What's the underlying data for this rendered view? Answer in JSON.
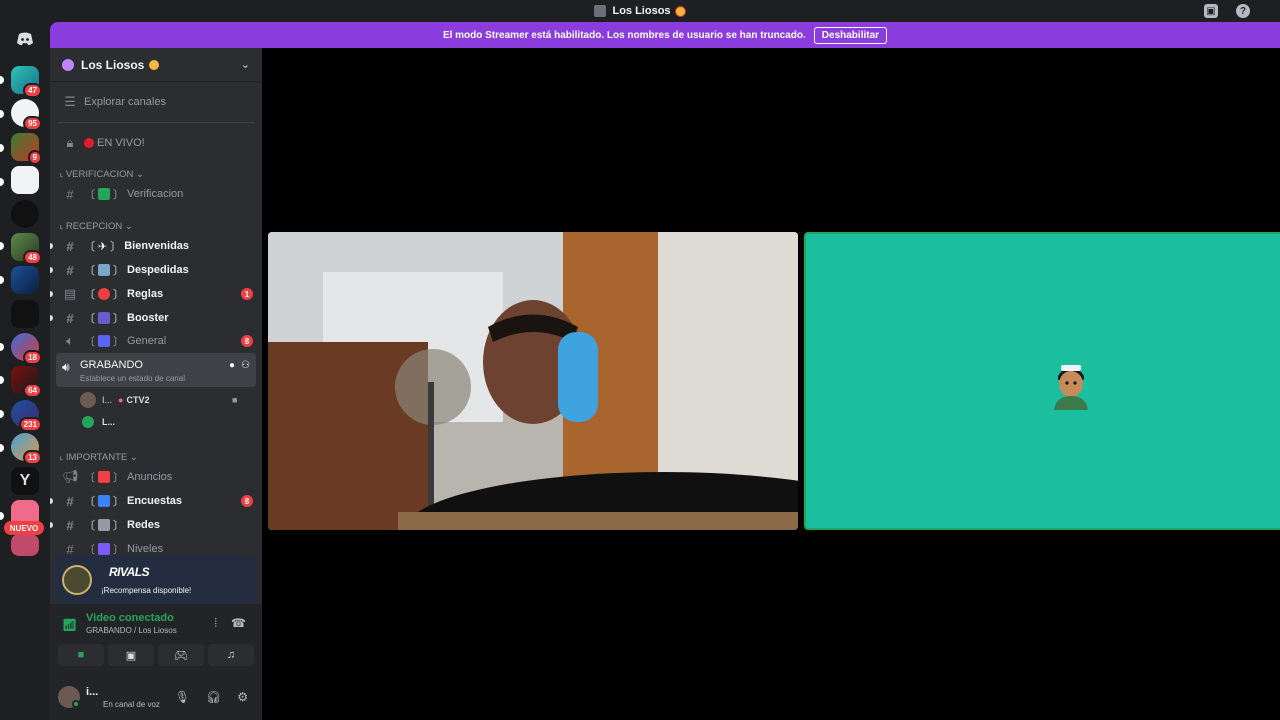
{
  "window": {
    "title": "Los Liosos"
  },
  "banner": {
    "message": "El modo Streamer está habilitado. Los nombres de usuario se han truncado.",
    "button": "Deshabilitar"
  },
  "guild_rail": {
    "badges": [
      "47",
      "95",
      "9",
      "48",
      "18",
      "64",
      "231",
      "13"
    ],
    "nuevo_label": "NUEVO"
  },
  "server": {
    "name": "Los Liosos"
  },
  "channels": {
    "explore": "Explorar canales",
    "live": "EN VIVO!",
    "categories": {
      "verificacion": "VERIFICACION",
      "recepcion": "RECEPCION",
      "importante": "IMPORTANTE"
    },
    "items": {
      "verificacion": "Verificacion",
      "bienvenidas": "Bienvenidas",
      "despedidas": "Despedidas",
      "reglas": "Reglas",
      "reglas_badge": "1",
      "booster": "Booster",
      "general": "General",
      "general_badge": "8",
      "grabando": "GRABANDO",
      "grabando_status": "Establece un estado de canal",
      "anuncios": "Anuncios",
      "encuestas": "Encuestas",
      "encuestas_badge": "8",
      "redes": "Redes",
      "niveles": "Niveles"
    },
    "voice_users": [
      {
        "name": "I...",
        "tag": "CTV2"
      },
      {
        "name": "L..."
      }
    ]
  },
  "promo": {
    "logo": "RIVALS",
    "text": "¡Recompensa disponible!"
  },
  "voice_panel": {
    "status": "Video conectado",
    "location": "GRABANDO / Los Liosos"
  },
  "user": {
    "name": "i...",
    "status": "En canal de voz"
  },
  "colors": {
    "banner": "#8b3cdc",
    "connected": "#23a55a",
    "badge": "#f23f43",
    "avatar_tile": "#1bbf9f"
  }
}
